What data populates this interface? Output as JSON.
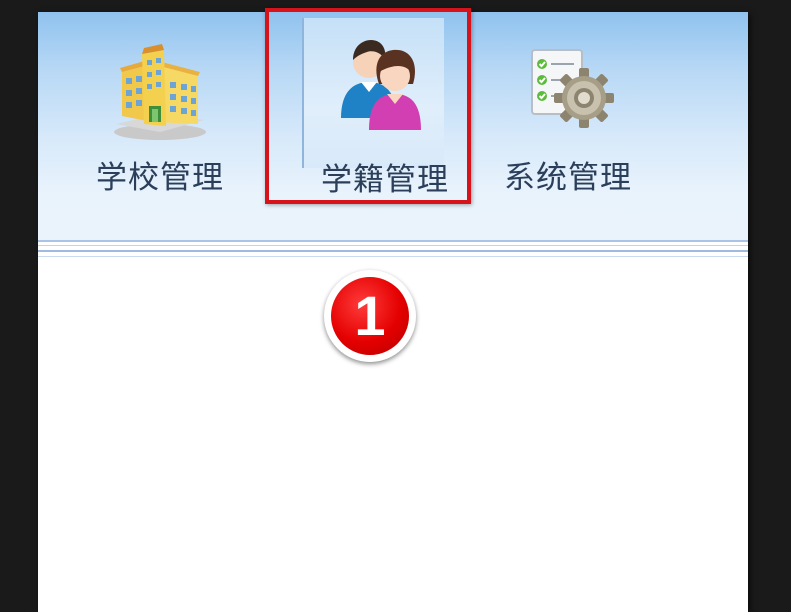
{
  "toolbar": {
    "items": [
      {
        "label": "学校管理",
        "icon": "school-building-icon"
      },
      {
        "label": "学籍管理",
        "icon": "student-records-icon"
      },
      {
        "label": "系统管理",
        "icon": "system-settings-icon"
      }
    ],
    "highlighted_item": "学籍管理"
  },
  "callout": {
    "number": "1"
  },
  "colors": {
    "highlight_border": "#d6121a",
    "badge_red": "#e40000",
    "toolbar_top": "#8fc2ee",
    "label_text": "#2b3f5a"
  }
}
